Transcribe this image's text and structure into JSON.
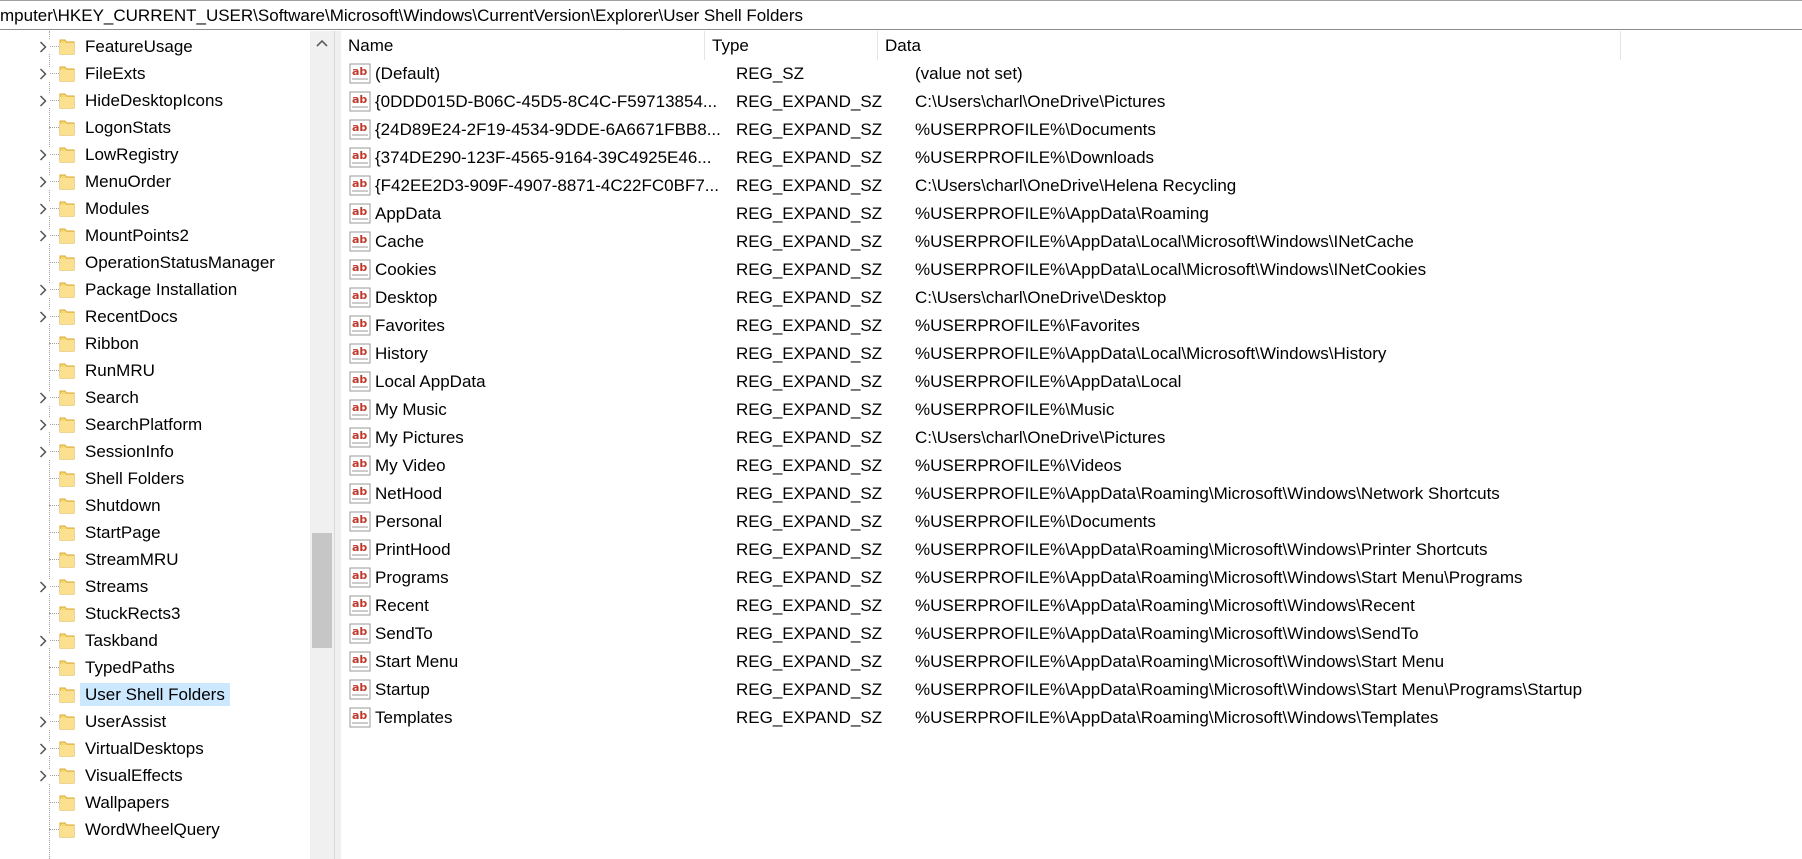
{
  "address": {
    "path": "mputer\\HKEY_CURRENT_USER\\Software\\Microsoft\\Windows\\CurrentVersion\\Explorer\\User Shell Folders"
  },
  "tree": {
    "items": [
      {
        "label": "FeatureUsage",
        "expandable": true,
        "selected": false
      },
      {
        "label": "FileExts",
        "expandable": true,
        "selected": false
      },
      {
        "label": "HideDesktopIcons",
        "expandable": true,
        "selected": false
      },
      {
        "label": "LogonStats",
        "expandable": false,
        "selected": false
      },
      {
        "label": "LowRegistry",
        "expandable": true,
        "selected": false
      },
      {
        "label": "MenuOrder",
        "expandable": true,
        "selected": false
      },
      {
        "label": "Modules",
        "expandable": true,
        "selected": false
      },
      {
        "label": "MountPoints2",
        "expandable": true,
        "selected": false
      },
      {
        "label": "OperationStatusManager",
        "expandable": false,
        "selected": false
      },
      {
        "label": "Package Installation",
        "expandable": true,
        "selected": false
      },
      {
        "label": "RecentDocs",
        "expandable": true,
        "selected": false
      },
      {
        "label": "Ribbon",
        "expandable": false,
        "selected": false
      },
      {
        "label": "RunMRU",
        "expandable": false,
        "selected": false
      },
      {
        "label": "Search",
        "expandable": true,
        "selected": false
      },
      {
        "label": "SearchPlatform",
        "expandable": true,
        "selected": false
      },
      {
        "label": "SessionInfo",
        "expandable": true,
        "selected": false
      },
      {
        "label": "Shell Folders",
        "expandable": false,
        "selected": false
      },
      {
        "label": "Shutdown",
        "expandable": false,
        "selected": false
      },
      {
        "label": "StartPage",
        "expandable": false,
        "selected": false
      },
      {
        "label": "StreamMRU",
        "expandable": false,
        "selected": false
      },
      {
        "label": "Streams",
        "expandable": true,
        "selected": false
      },
      {
        "label": "StuckRects3",
        "expandable": false,
        "selected": false
      },
      {
        "label": "Taskband",
        "expandable": true,
        "selected": false
      },
      {
        "label": "TypedPaths",
        "expandable": false,
        "selected": false
      },
      {
        "label": "User Shell Folders",
        "expandable": false,
        "selected": true
      },
      {
        "label": "UserAssist",
        "expandable": true,
        "selected": false
      },
      {
        "label": "VirtualDesktops",
        "expandable": true,
        "selected": false
      },
      {
        "label": "VisualEffects",
        "expandable": true,
        "selected": false
      },
      {
        "label": "Wallpapers",
        "expandable": false,
        "selected": false
      },
      {
        "label": "WordWheelQuery",
        "expandable": false,
        "selected": false
      }
    ]
  },
  "list": {
    "columns": {
      "name": "Name",
      "type": "Type",
      "data": "Data"
    },
    "rows": [
      {
        "name": "(Default)",
        "type": "REG_SZ",
        "data": "(value not set)"
      },
      {
        "name": "{0DDD015D-B06C-45D5-8C4C-F59713854...",
        "type": "REG_EXPAND_SZ",
        "data": "C:\\Users\\charl\\OneDrive\\Pictures"
      },
      {
        "name": "{24D89E24-2F19-4534-9DDE-6A6671FBB8...",
        "type": "REG_EXPAND_SZ",
        "data": "%USERPROFILE%\\Documents"
      },
      {
        "name": "{374DE290-123F-4565-9164-39C4925E46...",
        "type": "REG_EXPAND_SZ",
        "data": "%USERPROFILE%\\Downloads"
      },
      {
        "name": "{F42EE2D3-909F-4907-8871-4C22FC0BF7...",
        "type": "REG_EXPAND_SZ",
        "data": "C:\\Users\\charl\\OneDrive\\Helena Recycling"
      },
      {
        "name": "AppData",
        "type": "REG_EXPAND_SZ",
        "data": "%USERPROFILE%\\AppData\\Roaming"
      },
      {
        "name": "Cache",
        "type": "REG_EXPAND_SZ",
        "data": "%USERPROFILE%\\AppData\\Local\\Microsoft\\Windows\\INetCache"
      },
      {
        "name": "Cookies",
        "type": "REG_EXPAND_SZ",
        "data": "%USERPROFILE%\\AppData\\Local\\Microsoft\\Windows\\INetCookies"
      },
      {
        "name": "Desktop",
        "type": "REG_EXPAND_SZ",
        "data": "C:\\Users\\charl\\OneDrive\\Desktop"
      },
      {
        "name": "Favorites",
        "type": "REG_EXPAND_SZ",
        "data": "%USERPROFILE%\\Favorites"
      },
      {
        "name": "History",
        "type": "REG_EXPAND_SZ",
        "data": "%USERPROFILE%\\AppData\\Local\\Microsoft\\Windows\\History"
      },
      {
        "name": "Local AppData",
        "type": "REG_EXPAND_SZ",
        "data": "%USERPROFILE%\\AppData\\Local"
      },
      {
        "name": "My Music",
        "type": "REG_EXPAND_SZ",
        "data": "%USERPROFILE%\\Music"
      },
      {
        "name": "My Pictures",
        "type": "REG_EXPAND_SZ",
        "data": "C:\\Users\\charl\\OneDrive\\Pictures"
      },
      {
        "name": "My Video",
        "type": "REG_EXPAND_SZ",
        "data": "%USERPROFILE%\\Videos"
      },
      {
        "name": "NetHood",
        "type": "REG_EXPAND_SZ",
        "data": "%USERPROFILE%\\AppData\\Roaming\\Microsoft\\Windows\\Network Shortcuts"
      },
      {
        "name": "Personal",
        "type": "REG_EXPAND_SZ",
        "data": "%USERPROFILE%\\Documents"
      },
      {
        "name": "PrintHood",
        "type": "REG_EXPAND_SZ",
        "data": "%USERPROFILE%\\AppData\\Roaming\\Microsoft\\Windows\\Printer Shortcuts"
      },
      {
        "name": "Programs",
        "type": "REG_EXPAND_SZ",
        "data": "%USERPROFILE%\\AppData\\Roaming\\Microsoft\\Windows\\Start Menu\\Programs"
      },
      {
        "name": "Recent",
        "type": "REG_EXPAND_SZ",
        "data": "%USERPROFILE%\\AppData\\Roaming\\Microsoft\\Windows\\Recent"
      },
      {
        "name": "SendTo",
        "type": "REG_EXPAND_SZ",
        "data": "%USERPROFILE%\\AppData\\Roaming\\Microsoft\\Windows\\SendTo"
      },
      {
        "name": "Start Menu",
        "type": "REG_EXPAND_SZ",
        "data": "%USERPROFILE%\\AppData\\Roaming\\Microsoft\\Windows\\Start Menu"
      },
      {
        "name": "Startup",
        "type": "REG_EXPAND_SZ",
        "data": "%USERPROFILE%\\AppData\\Roaming\\Microsoft\\Windows\\Start Menu\\Programs\\Startup"
      },
      {
        "name": "Templates",
        "type": "REG_EXPAND_SZ",
        "data": "%USERPROFILE%\\AppData\\Roaming\\Microsoft\\Windows\\Templates"
      }
    ]
  },
  "icons": {
    "folder": "folder-icon",
    "chevron": "chevron-right-icon",
    "string_value": "string-value-icon",
    "scroll_up": "scroll-up-arrow-icon"
  },
  "colors": {
    "selection": "#cce8ff",
    "folder": "#f8d775",
    "icon_red": "#c0392b"
  }
}
